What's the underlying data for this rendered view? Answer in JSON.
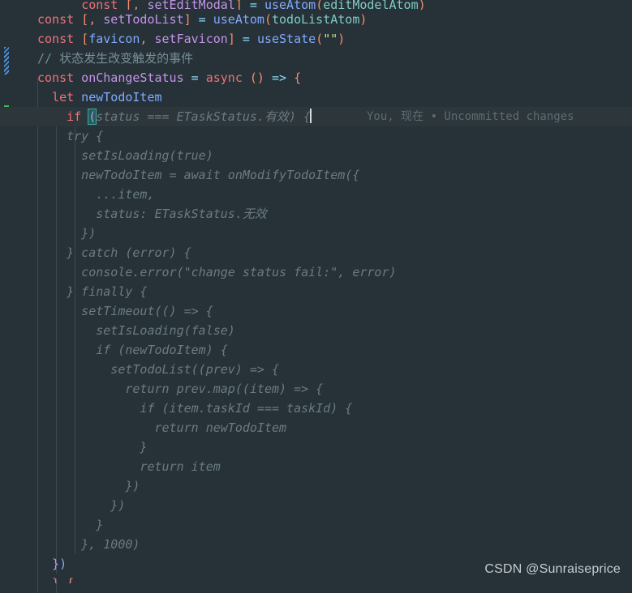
{
  "editor": {
    "theme_bg": "#263238",
    "current_line_bg": "#2c363b",
    "lines": [
      {
        "indent_guides": 0,
        "text": "const [, setEditModal] = useAtom(editModelAtom)"
      },
      {
        "indent_guides": 0,
        "text": "const [, setTodoList] = useAtom(todoListAtom)"
      },
      {
        "indent_guides": 0,
        "text": "const [favicon, setFavicon] = useState(\"\")"
      },
      {
        "indent_guides": 0,
        "text": "// 状态发生改变触发的事件"
      },
      {
        "indent_guides": 0,
        "text": "const onChangeStatus = async () => {"
      },
      {
        "indent_guides": 1,
        "text": "  let newTodoItem"
      },
      {
        "indent_guides": 1,
        "text": "  if (status === ETaskStatus.有效) {"
      },
      {
        "indent_guides": 2,
        "text": "    try {"
      },
      {
        "indent_guides": 2,
        "text": "      setIsLoading(true)"
      },
      {
        "indent_guides": 2,
        "text": "      newTodoItem = await onModifyTodoItem({"
      },
      {
        "indent_guides": 2,
        "text": "        ...item,"
      },
      {
        "indent_guides": 2,
        "text": "        status: ETaskStatus.无效"
      },
      {
        "indent_guides": 2,
        "text": "      })"
      },
      {
        "indent_guides": 2,
        "text": "    } catch (error) {"
      },
      {
        "indent_guides": 2,
        "text": "      console.error(\"change status fail:\", error)"
      },
      {
        "indent_guides": 2,
        "text": "    } finally {"
      },
      {
        "indent_guides": 2,
        "text": "      setTimeout(() => {"
      },
      {
        "indent_guides": 2,
        "text": "        setIsLoading(false)"
      },
      {
        "indent_guides": 2,
        "text": "        if (newTodoItem) {"
      },
      {
        "indent_guides": 2,
        "text": "          setTodoList((prev) => {"
      },
      {
        "indent_guides": 2,
        "text": "            return prev.map((item) => {"
      },
      {
        "indent_guides": 2,
        "text": "              if (item.taskId === taskId) {"
      },
      {
        "indent_guides": 2,
        "text": "                return newTodoItem"
      },
      {
        "indent_guides": 2,
        "text": "              }"
      },
      {
        "indent_guides": 2,
        "text": "              return item"
      },
      {
        "indent_guides": 2,
        "text": "            })"
      },
      {
        "indent_guides": 2,
        "text": "          })"
      },
      {
        "indent_guides": 2,
        "text": "        }"
      },
      {
        "indent_guides": 2,
        "text": "      }, 1000)"
      },
      {
        "indent_guides": 2,
        "text": "    }"
      },
      {
        "indent_guides": 1,
        "text": "  })"
      }
    ],
    "tokens": {
      "l0_const": "const",
      "l0_br_open": "[,",
      "l0_setter": " setEditModal",
      "l0_br_close": "]",
      "l0_eq": " = ",
      "l0_fn": "useAtom",
      "l0_paren_open": "(",
      "l0_arg": "editModelAtom",
      "l0_paren_close": ")",
      "l1_const": "const",
      "l1_br_open": "[,",
      "l1_setter": " setTodoList",
      "l1_br_close": "]",
      "l1_eq": " = ",
      "l1_fn": "useAtom",
      "l1_paren_open": "(",
      "l1_arg": "todoListAtom",
      "l1_paren_close": ")",
      "l2_const": "const",
      "l2_br_open": "[",
      "l2_name": "favicon",
      "l2_comma": ", ",
      "l2_setter": "setFavicon",
      "l2_br_close": "]",
      "l2_eq": " = ",
      "l2_fn": "useState",
      "l2_paren_open": "(",
      "l2_str": "\"\"",
      "l2_paren_close": ")",
      "l3_comment": "// 状态发生改变触发的事件",
      "l4_const": "const",
      "l4_name": " onChangeStatus",
      "l4_eq": " = ",
      "l4_async": "async",
      "l4_parens": " ()",
      "l4_arrow": " => ",
      "l4_brace": "{",
      "l5_let": "let",
      "l5_name": " newTodoItem",
      "l6_if": "if",
      "l6_space": " ",
      "l6_paren": "(",
      "l6_ghost": "status === ETaskStatus.有效) {",
      "l_last_brace": "}",
      "l_last_paren": ")"
    },
    "ghost_lines": [
      "    try {",
      "      setIsLoading(true)",
      "      newTodoItem = await onModifyTodoItem({",
      "        ...item,",
      "        status: ETaskStatus.无效",
      "      })",
      "    } catch (error) {",
      "      console.error(\"change status fail:\", error)",
      "    } finally {",
      "      setTimeout(() => {",
      "        setIsLoading(false)",
      "        if (newTodoItem) {",
      "          setTodoList((prev) => {",
      "            return prev.map((item) => {",
      "              if (item.taskId === taskId) {",
      "                return newTodoItem",
      "              }",
      "              return item",
      "            })",
      "          })",
      "        }",
      "      }, 1000)",
      "    }"
    ]
  },
  "blame": {
    "author": "You",
    "separator": "，",
    "time": "现在",
    "bullet": "•",
    "message": "Uncommitted changes",
    "full": "You, 现在 • Uncommitted changes",
    "color": "#5d6c73"
  },
  "gutter": {
    "pending_marker_label": "pending-change",
    "pending_color": "#4c8fd6",
    "added_marker_label": "added-line",
    "added_color": "#3fb950"
  },
  "watermark": {
    "text": "CSDN @Sunraiseprice"
  }
}
